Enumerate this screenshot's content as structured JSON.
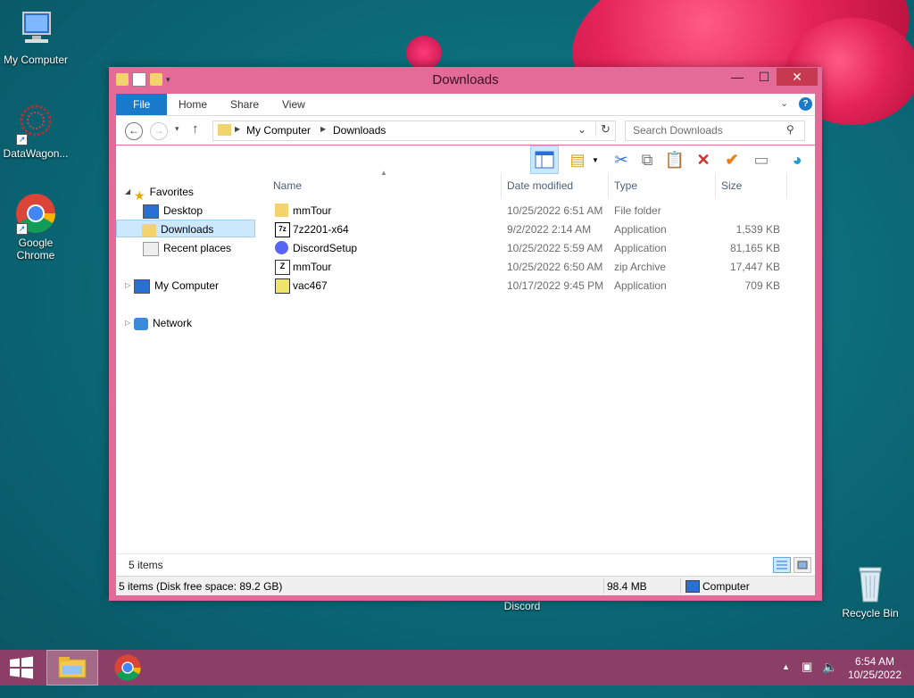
{
  "desktop": {
    "icons": [
      {
        "label": "My Computer"
      },
      {
        "label": "DataWagon..."
      },
      {
        "label": "Google Chrome"
      },
      {
        "label": "Discord"
      },
      {
        "label": "Recycle Bin"
      }
    ]
  },
  "window": {
    "title": "Downloads",
    "controls": {
      "minimize": "—",
      "maximize": "☐",
      "close": "✕"
    }
  },
  "ribbon": {
    "tabs": [
      "File",
      "Home",
      "Share",
      "View"
    ]
  },
  "address": {
    "breadcrumb": [
      "My Computer",
      "Downloads"
    ],
    "search_placeholder": "Search Downloads"
  },
  "nav": {
    "favorites": "Favorites",
    "desktop": "Desktop",
    "downloads": "Downloads",
    "recent": "Recent places",
    "my_computer": "My Computer",
    "network": "Network"
  },
  "files": {
    "columns": [
      "Name",
      "Date modified",
      "Type",
      "Size"
    ],
    "rows": [
      {
        "name": "mmTour",
        "date": "10/25/2022 6:51 AM",
        "type": "File folder",
        "size": "",
        "icon": "folder-icon"
      },
      {
        "name": "7z2201-x64",
        "date": "9/2/2022 2:14 AM",
        "type": "Application",
        "size": "1,539 KB",
        "icon": "7zip-icon"
      },
      {
        "name": "DiscordSetup",
        "date": "10/25/2022 5:59 AM",
        "type": "Application",
        "size": "81,165 KB",
        "icon": "discord-icon"
      },
      {
        "name": "mmTour",
        "date": "10/25/2022 6:50 AM",
        "type": "zip Archive",
        "size": "17,447 KB",
        "icon": "zip-icon"
      },
      {
        "name": "vac467",
        "date": "10/17/2022 9:45 PM",
        "type": "Application",
        "size": "709 KB",
        "icon": "app-icon"
      }
    ]
  },
  "footer": {
    "items_count": "5 items",
    "status_left": "5 items (Disk free space: 89.2 GB)",
    "status_size": "98.4 MB",
    "status_location": "Computer"
  },
  "taskbar": {
    "time": "6:54 AM",
    "date": "10/25/2022"
  },
  "colors": {
    "window_frame": "#e46b97",
    "file_tab": "#1979ca",
    "taskbar": "#8b3f66"
  }
}
